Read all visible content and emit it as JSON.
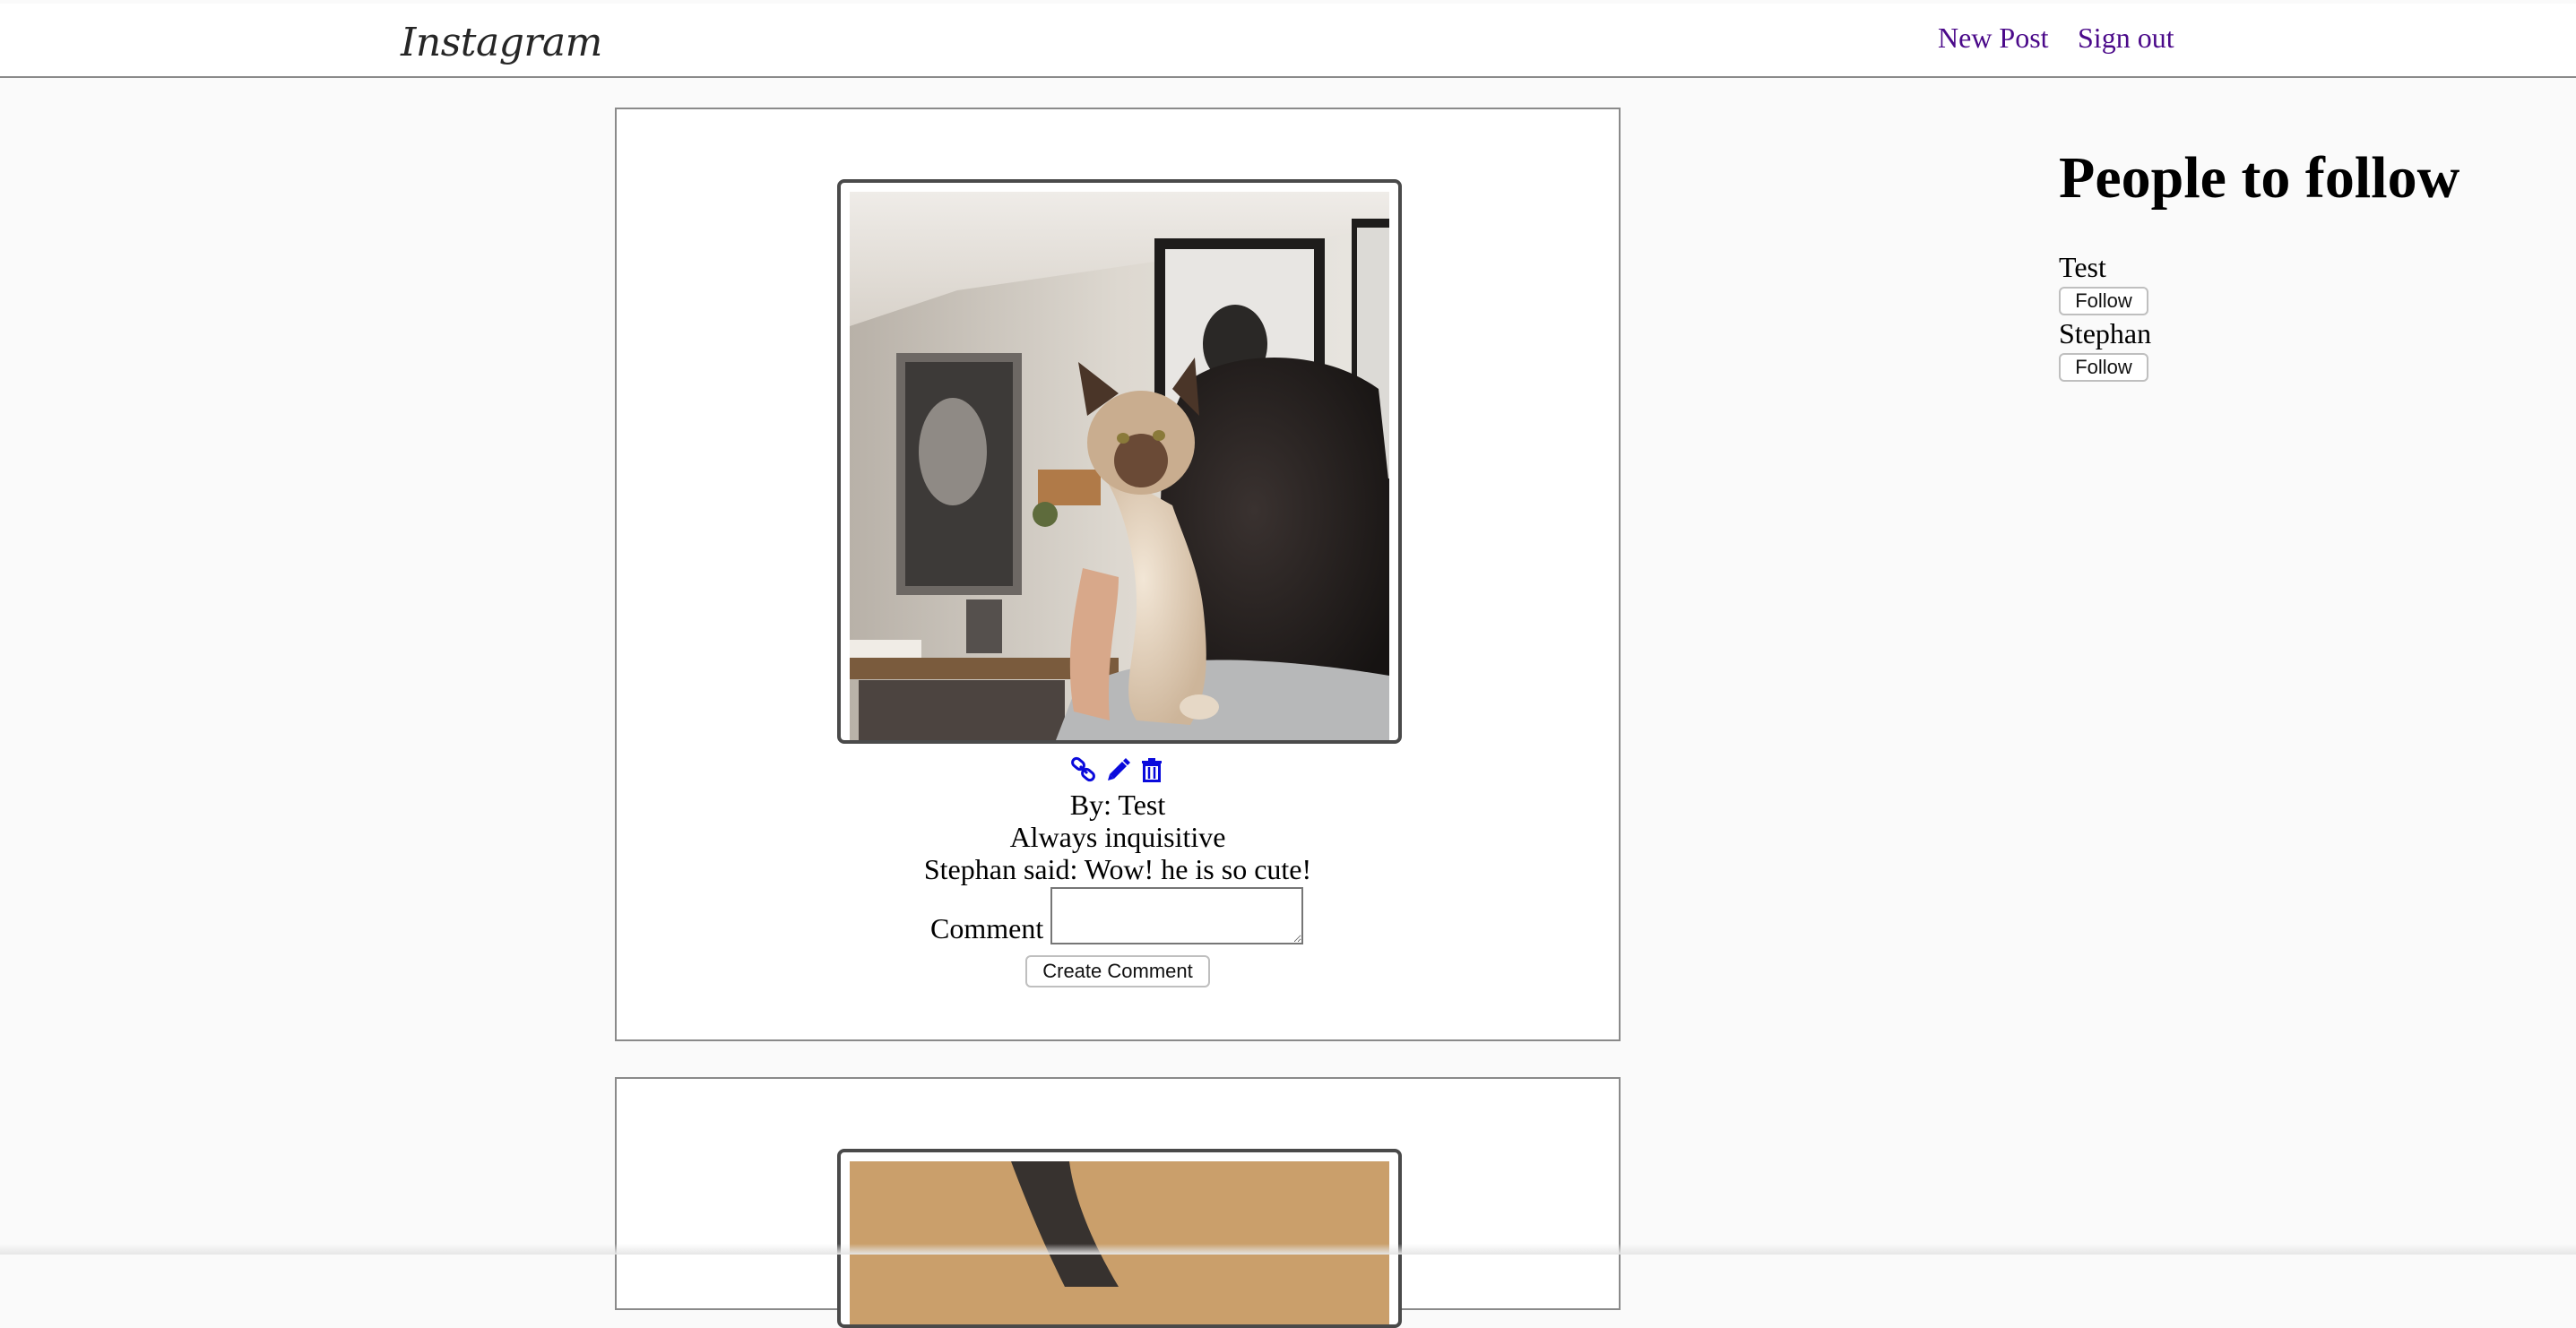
{
  "nav": {
    "logo_text": "Instagram",
    "new_post_label": "New Post",
    "sign_out_label": "Sign out",
    "link_color": "#4b0a8a"
  },
  "posts": [
    {
      "image_subject": "siamese cat perched on a man's shoulder in a living room",
      "icons": [
        "link-icon",
        "pencil-icon",
        "trash-icon"
      ],
      "author_line": "By: Test",
      "caption": "Always inquisitive",
      "comments": [
        "Stephan said: Wow! he is so cute!"
      ],
      "comment_label": "Comment",
      "comment_value": "",
      "submit_label": "Create Comment"
    },
    {
      "image_subject": "partial photo with sandy beige background and dark shape"
    }
  ],
  "sidebar": {
    "title": "People to follow",
    "suggestions": [
      {
        "name": "Test",
        "button_label": "Follow"
      },
      {
        "name": "Stephan",
        "button_label": "Follow"
      }
    ]
  },
  "colors": {
    "page_background": "#fafafa",
    "card_background": "#ffffff",
    "icon_blue": "#0a0adc"
  }
}
